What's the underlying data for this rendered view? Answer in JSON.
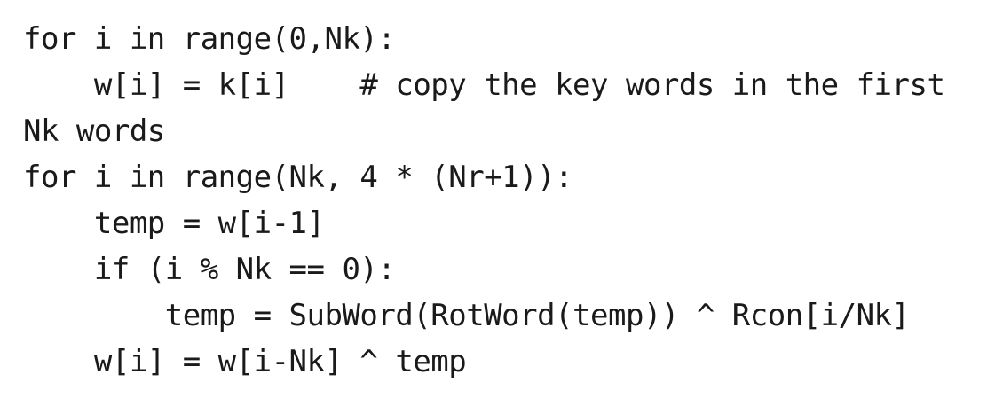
{
  "code": {
    "lines": [
      "for i in range(0,Nk):",
      "    w[i] = k[i]    # copy the key words in the first",
      "Nk words",
      "for i in range(Nk, 4 * (Nr+1)):",
      "    temp = w[i-1]",
      "    if (i % Nk == 0):",
      "        temp = SubWord(RotWord(temp)) ^ Rcon[i/Nk]",
      "    w[i] = w[i-Nk] ^ temp"
    ]
  }
}
